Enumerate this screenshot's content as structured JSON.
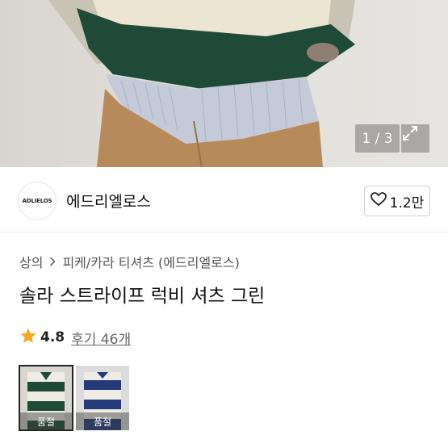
{
  "gallery": {
    "counter": "1 / 3",
    "current": 1,
    "total": 3
  },
  "brand": {
    "logo_text": "ADLIELOS",
    "name": "에드리엘로스"
  },
  "like": {
    "count": "1.2만"
  },
  "breadcrumb": [
    "상의",
    "피케/카라 티셔츠 (에드리엘로스)"
  ],
  "product": {
    "title": "솔라 스트라이프 럭비 셔츠 그린"
  },
  "rating": {
    "score": "4.8",
    "review_label": "후기 46개"
  },
  "options": [
    {
      "status": "품절",
      "colors": [
        "#1f4a36",
        "#efece4"
      ]
    },
    {
      "status": "품절",
      "colors": [
        "#243a7a",
        "#efece4"
      ]
    }
  ],
  "colors": {
    "star": "#f5a623",
    "sweater": "#1e4a37",
    "pants": "#b78a5c"
  }
}
